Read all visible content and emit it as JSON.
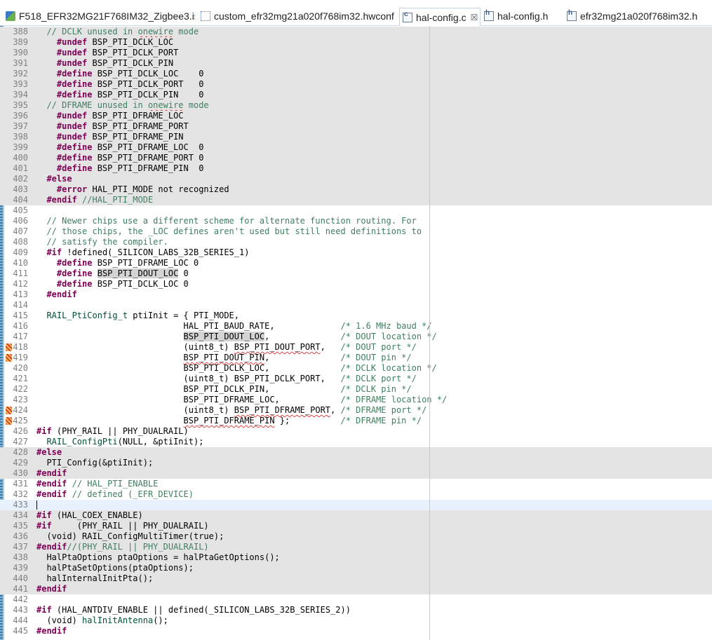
{
  "tabs": [
    {
      "label": "F518_EFR32MG21F768IM32_Zigbee3.isc",
      "icon": "project-icon",
      "active": false
    },
    {
      "label": "custom_efr32mg21a020f768im32.hwconf",
      "icon": "hwconf-icon",
      "active": false
    },
    {
      "label": "hal-config.c",
      "icon": "c-file-icon",
      "active": true,
      "close": "☒"
    },
    {
      "label": "hal-config.h",
      "icon": "h-file-icon",
      "active": false
    },
    {
      "label": "efr32mg21a020f768im32.h",
      "icon": "h-file-icon",
      "active": false
    }
  ],
  "editor": {
    "current_line": 433,
    "lines": [
      {
        "n": "388",
        "bg": "ifdef",
        "segs": [
          {
            "t": "  "
          },
          {
            "c": "cm",
            "t": "// DCLK unused in "
          },
          {
            "c": "cm sq",
            "t": "onewire"
          },
          {
            "c": "cm",
            "t": " mode"
          }
        ]
      },
      {
        "n": "389",
        "bg": "ifdef",
        "segs": [
          {
            "t": "    "
          },
          {
            "c": "kw",
            "t": "#undef"
          },
          {
            "t": " BSP_PTI_DCLK_LOC"
          }
        ]
      },
      {
        "n": "390",
        "bg": "ifdef",
        "segs": [
          {
            "t": "    "
          },
          {
            "c": "kw",
            "t": "#undef"
          },
          {
            "t": " BSP_PTI_DCLK_PORT"
          }
        ]
      },
      {
        "n": "391",
        "bg": "ifdef",
        "segs": [
          {
            "t": "    "
          },
          {
            "c": "kw",
            "t": "#undef"
          },
          {
            "t": " BSP_PTI_DCLK_PIN"
          }
        ]
      },
      {
        "n": "392",
        "bg": "ifdef",
        "segs": [
          {
            "t": "    "
          },
          {
            "c": "kw",
            "t": "#define"
          },
          {
            "t": " BSP_PTI_DCLK_LOC    0"
          }
        ]
      },
      {
        "n": "393",
        "bg": "ifdef",
        "segs": [
          {
            "t": "    "
          },
          {
            "c": "kw",
            "t": "#define"
          },
          {
            "t": " BSP_PTI_DCLK_PORT   0"
          }
        ]
      },
      {
        "n": "394",
        "bg": "ifdef",
        "segs": [
          {
            "t": "    "
          },
          {
            "c": "kw",
            "t": "#define"
          },
          {
            "t": " BSP_PTI_DCLK_PIN    0"
          }
        ]
      },
      {
        "n": "395",
        "bg": "ifdef",
        "segs": [
          {
            "t": "  "
          },
          {
            "c": "cm",
            "t": "// DFRAME unused in "
          },
          {
            "c": "cm sq",
            "t": "onewire"
          },
          {
            "c": "cm",
            "t": " mode"
          }
        ]
      },
      {
        "n": "396",
        "bg": "ifdef",
        "segs": [
          {
            "t": "    "
          },
          {
            "c": "kw",
            "t": "#undef"
          },
          {
            "t": " BSP_PTI_DFRAME_LOC"
          }
        ]
      },
      {
        "n": "397",
        "bg": "ifdef",
        "segs": [
          {
            "t": "    "
          },
          {
            "c": "kw",
            "t": "#undef"
          },
          {
            "t": " BSP_PTI_DFRAME_PORT"
          }
        ]
      },
      {
        "n": "398",
        "bg": "ifdef",
        "segs": [
          {
            "t": "    "
          },
          {
            "c": "kw",
            "t": "#undef"
          },
          {
            "t": " BSP_PTI_DFRAME_PIN"
          }
        ]
      },
      {
        "n": "399",
        "bg": "ifdef",
        "segs": [
          {
            "t": "    "
          },
          {
            "c": "kw",
            "t": "#define"
          },
          {
            "t": " BSP_PTI_DFRAME_LOC  0"
          }
        ]
      },
      {
        "n": "400",
        "bg": "ifdef",
        "segs": [
          {
            "t": "    "
          },
          {
            "c": "kw",
            "t": "#define"
          },
          {
            "t": " BSP_PTI_DFRAME_PORT 0"
          }
        ]
      },
      {
        "n": "401",
        "bg": "ifdef",
        "segs": [
          {
            "t": "    "
          },
          {
            "c": "kw",
            "t": "#define"
          },
          {
            "t": " BSP_PTI_DFRAME_PIN  0"
          }
        ]
      },
      {
        "n": "402",
        "bg": "ifdef",
        "segs": [
          {
            "t": "  "
          },
          {
            "c": "kw",
            "t": "#else"
          }
        ]
      },
      {
        "n": "403",
        "bg": "ifdef",
        "segs": [
          {
            "t": "    "
          },
          {
            "c": "kw",
            "t": "#error"
          },
          {
            "t": " HAL_PTI_MODE not recognized"
          }
        ]
      },
      {
        "n": "404",
        "bg": "ifdef",
        "segs": [
          {
            "t": "  "
          },
          {
            "c": "kw",
            "t": "#endif"
          },
          {
            "t": " "
          },
          {
            "c": "cm",
            "t": "//HAL_PTI_MODE"
          }
        ]
      },
      {
        "n": "405",
        "segs": []
      },
      {
        "n": "406",
        "segs": [
          {
            "t": "  "
          },
          {
            "c": "cm",
            "t": "// Newer chips use a different scheme for alternate function routing. For"
          }
        ]
      },
      {
        "n": "407",
        "segs": [
          {
            "t": "  "
          },
          {
            "c": "cm",
            "t": "// those chips, the _LOC defines aren't used but still need definitions to"
          }
        ]
      },
      {
        "n": "408",
        "segs": [
          {
            "t": "  "
          },
          {
            "c": "cm",
            "t": "// satisfy the compiler."
          }
        ]
      },
      {
        "n": "409",
        "segs": [
          {
            "t": "  "
          },
          {
            "c": "kw",
            "t": "#if"
          },
          {
            "t": " !defined(_SILICON_LABS_32B_SERIES_1)"
          }
        ]
      },
      {
        "n": "410",
        "segs": [
          {
            "t": "    "
          },
          {
            "c": "kw",
            "t": "#define"
          },
          {
            "t": " BSP_PTI_DFRAME_LOC 0"
          }
        ]
      },
      {
        "n": "411",
        "segs": [
          {
            "t": "    "
          },
          {
            "c": "kw",
            "t": "#define"
          },
          {
            "t": " "
          },
          {
            "c": "occ",
            "t": "BSP_PTI_DOUT_LOC"
          },
          {
            "t": " 0"
          }
        ]
      },
      {
        "n": "412",
        "segs": [
          {
            "t": "    "
          },
          {
            "c": "kw",
            "t": "#define"
          },
          {
            "t": " BSP_PTI_DCLK_LOC 0"
          }
        ]
      },
      {
        "n": "413",
        "segs": [
          {
            "t": "  "
          },
          {
            "c": "kw",
            "t": "#endif"
          }
        ]
      },
      {
        "n": "414",
        "segs": []
      },
      {
        "n": "415",
        "segs": [
          {
            "t": "  "
          },
          {
            "c": "ty",
            "t": "RAIL_PtiConfig_t"
          },
          {
            "t": " ptiInit = { PTI_MODE,"
          }
        ]
      },
      {
        "n": "416",
        "segs": [
          {
            "t": "                             HAL_PTI_BAUD_RATE,             "
          },
          {
            "c": "cm",
            "t": "/* 1.6 MHz baud */"
          }
        ]
      },
      {
        "n": "417",
        "segs": [
          {
            "t": "                             "
          },
          {
            "c": "occ",
            "t": "BSP_PTI_DOUT_LOC"
          },
          {
            "t": ",              "
          },
          {
            "c": "cm",
            "t": "/* DOUT location */"
          }
        ]
      },
      {
        "n": "418",
        "mark": true,
        "segs": [
          {
            "t": "                             (uint8_t) "
          },
          {
            "c": "sq",
            "t": "BSP_PTI_DOUT_PORT"
          },
          {
            "t": ",   "
          },
          {
            "c": "cm",
            "t": "/* DOUT port */"
          }
        ]
      },
      {
        "n": "419",
        "mark": true,
        "segs": [
          {
            "t": "                             "
          },
          {
            "c": "sq",
            "t": "BSP_PTI_DOUT_PIN"
          },
          {
            "t": ",              "
          },
          {
            "c": "cm",
            "t": "/* DOUT pin */"
          }
        ]
      },
      {
        "n": "420",
        "segs": [
          {
            "t": "                             BSP_PTI_DCLK_LOC,              "
          },
          {
            "c": "cm",
            "t": "/* DCLK location */"
          }
        ]
      },
      {
        "n": "421",
        "segs": [
          {
            "t": "                             (uint8_t) BSP_PTI_DCLK_PORT,   "
          },
          {
            "c": "cm",
            "t": "/* DCLK port */"
          }
        ]
      },
      {
        "n": "422",
        "segs": [
          {
            "t": "                             BSP_PTI_DCLK_PIN,              "
          },
          {
            "c": "cm",
            "t": "/* DCLK pin */"
          }
        ]
      },
      {
        "n": "423",
        "segs": [
          {
            "t": "                             BSP_PTI_DFRAME_LOC,            "
          },
          {
            "c": "cm",
            "t": "/* DFRAME location */"
          }
        ]
      },
      {
        "n": "424",
        "mark": true,
        "segs": [
          {
            "t": "                             (uint8_t) "
          },
          {
            "c": "sq",
            "t": "BSP_PTI_DFRAME_PORT"
          },
          {
            "t": ", "
          },
          {
            "c": "cm",
            "t": "/* DFRAME port */"
          }
        ]
      },
      {
        "n": "425",
        "mark": true,
        "segs": [
          {
            "t": "                             "
          },
          {
            "c": "sq",
            "t": "BSP_PTI_DFRAME_PIN"
          },
          {
            "t": " };          "
          },
          {
            "c": "cm",
            "t": "/* DFRAME pin */"
          }
        ]
      },
      {
        "n": "426",
        "segs": [
          {
            "c": "kw",
            "t": "#if"
          },
          {
            "t": " (PHY_RAIL || PHY_DUALRAIL)"
          }
        ]
      },
      {
        "n": "427",
        "segs": [
          {
            "t": "  "
          },
          {
            "c": "ty",
            "t": "RAIL_ConfigPti"
          },
          {
            "t": "(NULL, &ptiInit);"
          }
        ]
      },
      {
        "n": "428",
        "bg": "ifdef",
        "segs": [
          {
            "c": "kw",
            "t": "#else"
          }
        ]
      },
      {
        "n": "429",
        "bg": "ifdef",
        "segs": [
          {
            "t": "  PTI_Config(&ptiInit);"
          }
        ]
      },
      {
        "n": "430",
        "bg": "ifdef",
        "segs": [
          {
            "c": "kw",
            "t": "#endif"
          }
        ]
      },
      {
        "n": "431",
        "segs": [
          {
            "c": "kw",
            "t": "#endif"
          },
          {
            "t": " "
          },
          {
            "c": "cm",
            "t": "// HAL_PTI_ENABLE"
          }
        ]
      },
      {
        "n": "432",
        "segs": [
          {
            "c": "kw",
            "t": "#endif"
          },
          {
            "t": " "
          },
          {
            "c": "cm",
            "t": "// defined (_EFR_DEVICE)"
          }
        ]
      },
      {
        "n": "433",
        "bg": "current",
        "segs": []
      },
      {
        "n": "434",
        "bg": "ifdef",
        "segs": [
          {
            "c": "kw",
            "t": "#if"
          },
          {
            "t": " (HAL_COEX_ENABLE)"
          }
        ]
      },
      {
        "n": "435",
        "bg": "ifdef",
        "segs": [
          {
            "c": "kw",
            "t": "#if"
          },
          {
            "t": "     (PHY_RAIL || PHY_DUALRAIL)"
          }
        ]
      },
      {
        "n": "436",
        "bg": "ifdef",
        "segs": [
          {
            "t": "  (void) RAIL_ConfigMultiTimer(true);"
          }
        ]
      },
      {
        "n": "437",
        "bg": "ifdef",
        "segs": [
          {
            "c": "kw",
            "t": "#endif"
          },
          {
            "c": "cm",
            "t": "//(PHY_RAIL || PHY_DUALRAIL)"
          }
        ]
      },
      {
        "n": "438",
        "bg": "ifdef",
        "segs": [
          {
            "t": "  HalPtaOptions ptaOptions = halPtaGetOptions();"
          }
        ]
      },
      {
        "n": "439",
        "bg": "ifdef",
        "segs": [
          {
            "t": "  halPtaSetOptions(ptaOptions);"
          }
        ]
      },
      {
        "n": "440",
        "bg": "ifdef",
        "segs": [
          {
            "t": "  halInternalInitPta();"
          }
        ]
      },
      {
        "n": "441",
        "bg": "ifdef",
        "segs": [
          {
            "c": "kw",
            "t": "#endif"
          }
        ]
      },
      {
        "n": "442",
        "segs": []
      },
      {
        "n": "443",
        "segs": [
          {
            "c": "kw",
            "t": "#if"
          },
          {
            "t": " (HAL_ANTDIV_ENABLE || defined(_SILICON_LABS_32B_SERIES_2))"
          }
        ]
      },
      {
        "n": "444",
        "segs": [
          {
            "t": "  (void) "
          },
          {
            "c": "ty",
            "t": "halInitAntenna"
          },
          {
            "t": "();"
          }
        ]
      },
      {
        "n": "445",
        "segs": [
          {
            "c": "kw",
            "t": "#endif"
          }
        ]
      }
    ]
  },
  "colors": {
    "keyword": "#7f0055",
    "comment": "#3f7f5f",
    "inactive_block": "#e4e4e4",
    "current_line": "#e8f2fe"
  }
}
